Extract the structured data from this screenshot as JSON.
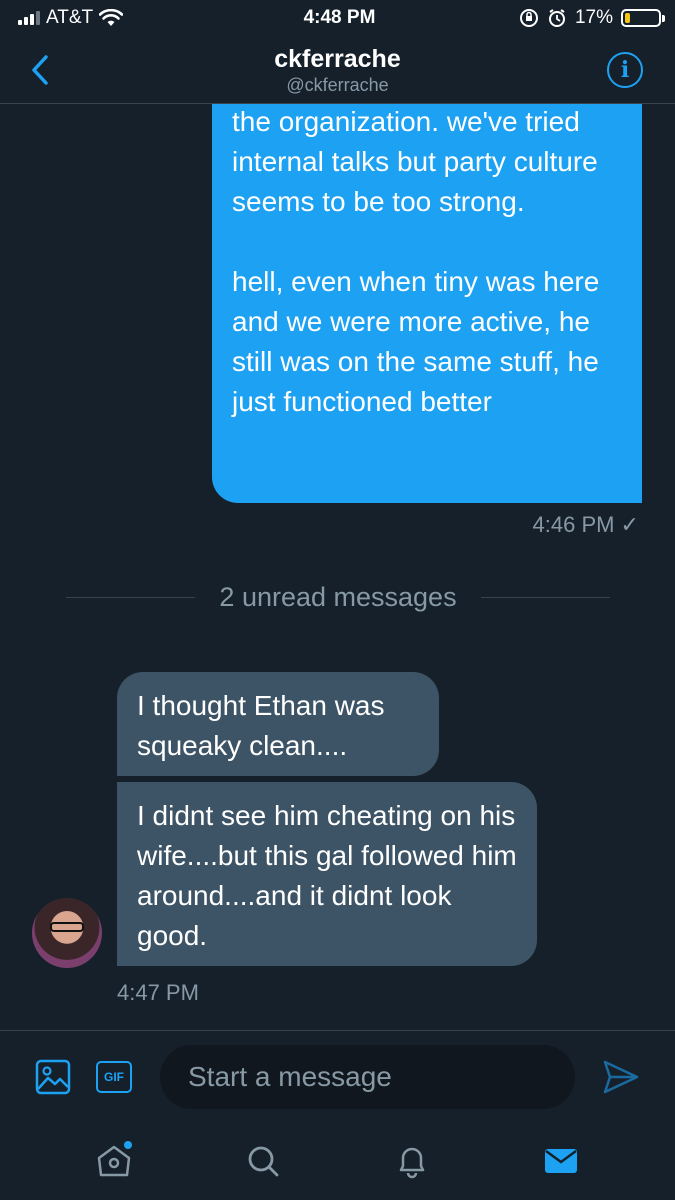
{
  "status_bar": {
    "carrier": "AT&T",
    "time": "4:48 PM",
    "battery": "17%",
    "battery_level": 0.17
  },
  "header": {
    "name": "ckferrache",
    "handle": "@ckferrache"
  },
  "messages": {
    "outgoing": {
      "text": "the organization. we've tried internal talks but party culture seems to be too strong.\n\nhell, even when tiny was here and we were more active, he still was on the same stuff, he just functioned better",
      "time": "4:46 PM ✓"
    },
    "unread_divider": "2 unread messages",
    "incoming": [
      {
        "text": "I thought Ethan was squeaky clean...."
      },
      {
        "text": "I didnt see him cheating on his wife....but this gal followed him around....and it didnt look good."
      }
    ],
    "incoming_time": "4:47 PM"
  },
  "composer": {
    "placeholder": "Start a message",
    "gif_label": "GIF"
  },
  "colors": {
    "background": "#15202b",
    "accent": "#1da1f2",
    "incoming_bubble": "#3d5466",
    "muted": "#8899a6"
  },
  "tabbar": {
    "icons": [
      "home-icon",
      "search-icon",
      "notifications-icon",
      "messages-icon"
    ]
  }
}
